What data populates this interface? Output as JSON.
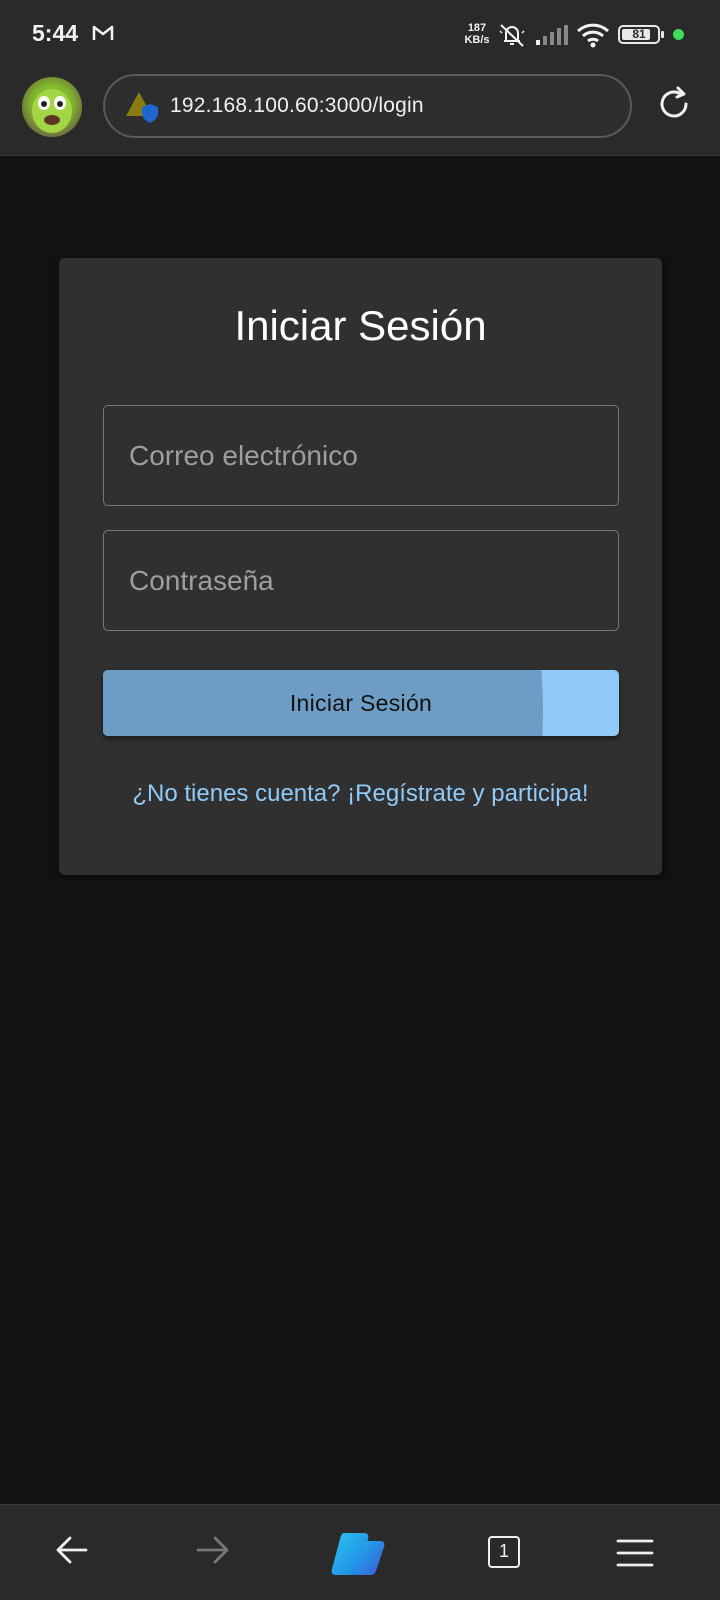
{
  "status_bar": {
    "time": "5:44",
    "network_speed_value": "187",
    "network_speed_unit": "KB/s",
    "battery_level": "81",
    "battery_fraction": 0.81,
    "dot_color": "#3ddc5a",
    "icons": [
      "gmail-icon",
      "mute-icon",
      "signal-icon",
      "wifi-icon",
      "battery-icon"
    ]
  },
  "browser": {
    "url": "192.168.100.60:3000/login",
    "profile_avatar": "avatar",
    "site_info_icon": "not-secure-warning-icon",
    "reload_icon": "reload-icon"
  },
  "login_card": {
    "title": "Iniciar Sesión",
    "email_placeholder": "Correo electrónico",
    "email_value": "",
    "password_placeholder": "Contraseña",
    "password_value": "",
    "submit_label": "Iniciar Sesión",
    "register_link": "¿No tienes cuenta? ¡Regístrate y participa!",
    "accent_color": "#90caf9"
  },
  "bottom_nav": {
    "items": [
      "back-arrow-icon",
      "forward-arrow-icon",
      "copilot-icon",
      "tabs-icon",
      "menu-icon"
    ],
    "tab_count": "1"
  }
}
